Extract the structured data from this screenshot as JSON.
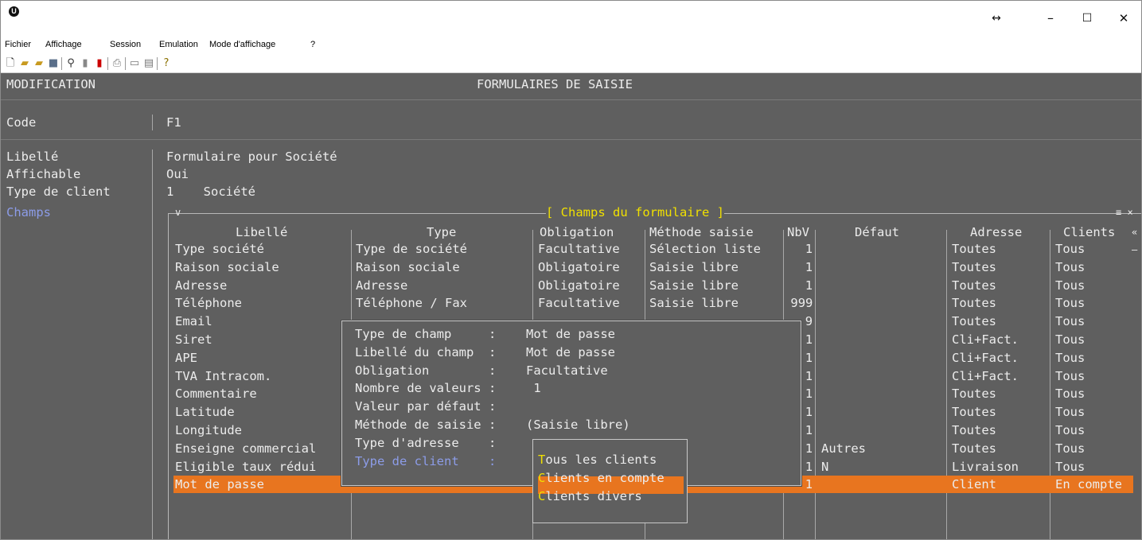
{
  "window": {
    "controls": {
      "resize": "↔",
      "minimize": "–",
      "maximize": "☐",
      "close": "✕"
    }
  },
  "menu": [
    "Fichier",
    "Affichage",
    "Session",
    "Emulation",
    "Mode d'affichage",
    "?"
  ],
  "toolbar_icons": [
    "new-icon",
    "open-icon",
    "connect-icon",
    "save-icon",
    "find-icon",
    "key-icon",
    "traffic-light-icon",
    "print-icon",
    "copy-screen-icon",
    "paste-icon",
    "help-icon"
  ],
  "screen": {
    "mode": "MODIFICATION",
    "title": "FORMULAIRES DE SAISIE",
    "fields": [
      {
        "label": "Code",
        "value": "F1"
      },
      {
        "label": "Libellé",
        "value": "Formulaire pour Société"
      },
      {
        "label": "Affichable",
        "value": "Oui"
      },
      {
        "label": "Type de client",
        "value": "1    Société"
      },
      {
        "label": "Champs",
        "value": ""
      }
    ]
  },
  "grid": {
    "title": "[ Champs du formulaire ]",
    "corner_left": "v",
    "corner_right": "≡ ×",
    "scroll_up": "«",
    "scroll_dash": "–",
    "columns": [
      "Libellé",
      "Type",
      "Obligation",
      "Méthode saisie",
      "NbV",
      "Défaut",
      "Adresse",
      "Clients"
    ],
    "rows": [
      [
        "Type société",
        "Type de société",
        "Facultative",
        "Sélection liste",
        "1",
        "",
        "Toutes",
        "Tous"
      ],
      [
        "Raison sociale",
        "Raison sociale",
        "Obligatoire",
        "Saisie libre",
        "1",
        "",
        "Toutes",
        "Tous"
      ],
      [
        "Adresse",
        "Adresse",
        "Obligatoire",
        "Saisie libre",
        "1",
        "",
        "Toutes",
        "Tous"
      ],
      [
        "Téléphone",
        "Téléphone / Fax",
        "Facultative",
        "Saisie libre",
        "999",
        "",
        "Toutes",
        "Tous"
      ],
      [
        "Email",
        "",
        "",
        "",
        "9",
        "",
        "Toutes",
        "Tous"
      ],
      [
        "Siret",
        "",
        "",
        "",
        "1",
        "",
        "Cli+Fact.",
        "Tous"
      ],
      [
        "APE",
        "",
        "",
        "",
        "1",
        "",
        "Cli+Fact.",
        "Tous"
      ],
      [
        "TVA Intracom.",
        "",
        "",
        "",
        "1",
        "",
        "Cli+Fact.",
        "Tous"
      ],
      [
        "Commentaire",
        "",
        "",
        "",
        "1",
        "",
        "Toutes",
        "Tous"
      ],
      [
        "Latitude",
        "",
        "",
        "",
        "1",
        "",
        "Toutes",
        "Tous"
      ],
      [
        "Longitude",
        "",
        "",
        "",
        "1",
        "",
        "Toutes",
        "Tous"
      ],
      [
        "Enseigne commercial",
        "",
        "",
        "",
        "1",
        "Autres",
        "Toutes",
        "Tous"
      ],
      [
        "Eligible taux rédui",
        "",
        "",
        "",
        "1",
        "N",
        "Livraison",
        "Tous"
      ],
      [
        "Mot de passe",
        "",
        "",
        "",
        "1",
        "",
        "Client",
        "En compte"
      ]
    ]
  },
  "popup": {
    "lines": [
      {
        "label": "Type de champ     :",
        "value": "Mot de passe"
      },
      {
        "label": "Libellé du champ  :",
        "value": "Mot de passe"
      },
      {
        "label": "Obligation        :",
        "value": "Facultative"
      },
      {
        "label": "Nombre de valeurs :",
        "value": " 1"
      },
      {
        "label": "Valeur par défaut :",
        "value": ""
      },
      {
        "label": "Méthode de saisie :",
        "value": "(Saisie libre)"
      },
      {
        "label": "Type d'adresse    :",
        "value": ""
      },
      {
        "label": "Type de client    :",
        "value": ""
      }
    ]
  },
  "submenu": {
    "items": [
      {
        "hot": "T",
        "rest": "ous les clients"
      },
      {
        "hot": "C",
        "rest": "lients en compte"
      },
      {
        "hot": "C",
        "rest": "lients divers"
      }
    ],
    "selected_index": 1
  },
  "colors": {
    "background": "#5f5f5f",
    "selection": "#e8751f",
    "hotkey": "#f0e000",
    "inactive_label": "#8c9ce8",
    "text": "#ececec"
  }
}
